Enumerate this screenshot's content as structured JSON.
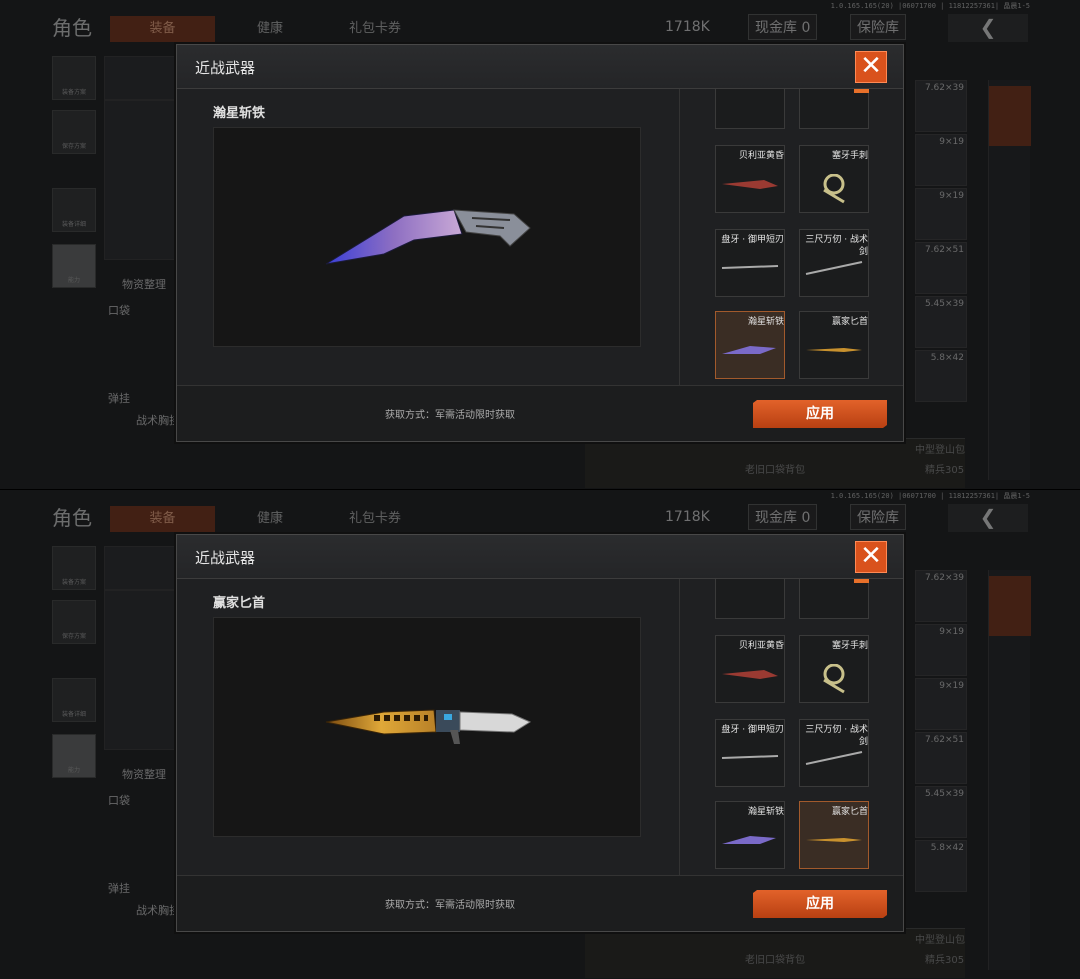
{
  "screens": [
    {
      "build_info": "1.0.165.165(20) |06071700 | 11812257361| 晶晨1-5",
      "page_title": "角色",
      "tabs": [
        "装备",
        "健康",
        "礼包卡券"
      ],
      "currency": {
        "money": "1718K",
        "cash_vault": "现金库 0",
        "safe_box": "保险库"
      },
      "back_icon": "chevron-left-icon",
      "sidebar": [
        "装备方案",
        "保存方案",
        "装备详细",
        "能力"
      ],
      "bg_labels": {
        "supplies": "物资整理",
        "pocket": "口袋",
        "ammo": "弹挂",
        "vest": "战术胸挂",
        "bag_left": "老旧口袋背包",
        "bag_right": "中型登山包",
        "level": "精兵305"
      },
      "ammo_column": [
        "7.62×39",
        "9×19",
        "9×19",
        "7.62×51",
        "5.45×39",
        "5.8×42"
      ],
      "modal": {
        "title": "近战武器",
        "close_icon": "close-icon",
        "selected_name": "瀚星斩铁",
        "obtain_text": "获取方式：军需活动限时获取",
        "apply_label": "应用",
        "items": [
          {
            "name": "",
            "equipped": false,
            "selected": false
          },
          {
            "name": "",
            "equipped": true,
            "selected": false
          },
          {
            "name": "贝利亚黄昏",
            "equipped": false,
            "selected": false
          },
          {
            "name": "塞牙手刺",
            "equipped": false,
            "selected": false
          },
          {
            "name": "盘牙 · 御甲短刃",
            "equipped": false,
            "selected": false
          },
          {
            "name": "三尺万仞 · 战术剑",
            "equipped": false,
            "selected": false
          },
          {
            "name": "瀚星斩铁",
            "equipped": false,
            "selected": true
          },
          {
            "name": "赢家匕首",
            "equipped": false,
            "selected": false
          }
        ]
      }
    },
    {
      "build_info": "1.0.165.165(20) |06071700 | 11812257361| 晶晨1-5",
      "page_title": "角色",
      "tabs": [
        "装备",
        "健康",
        "礼包卡券"
      ],
      "currency": {
        "money": "1718K",
        "cash_vault": "现金库 0",
        "safe_box": "保险库"
      },
      "back_icon": "chevron-left-icon",
      "sidebar": [
        "装备方案",
        "保存方案",
        "装备详细",
        "能力"
      ],
      "bg_labels": {
        "supplies": "物资整理",
        "pocket": "口袋",
        "ammo": "弹挂",
        "vest": "战术胸挂",
        "bag_left": "老旧口袋背包",
        "bag_right": "中型登山包",
        "level": "精兵305"
      },
      "ammo_column": [
        "7.62×39",
        "9×19",
        "9×19",
        "7.62×51",
        "5.45×39",
        "5.8×42"
      ],
      "modal": {
        "title": "近战武器",
        "close_icon": "close-icon",
        "selected_name": "赢家匕首",
        "obtain_text": "获取方式：军需活动限时获取",
        "apply_label": "应用",
        "items": [
          {
            "name": "",
            "equipped": false,
            "selected": false
          },
          {
            "name": "",
            "equipped": true,
            "selected": false
          },
          {
            "name": "贝利亚黄昏",
            "equipped": false,
            "selected": false
          },
          {
            "name": "塞牙手刺",
            "equipped": false,
            "selected": false
          },
          {
            "name": "盘牙 · 御甲短刃",
            "equipped": false,
            "selected": false
          },
          {
            "name": "三尺万仞 · 战术剑",
            "equipped": false,
            "selected": false
          },
          {
            "name": "瀚星斩铁",
            "equipped": false,
            "selected": false
          },
          {
            "name": "赢家匕首",
            "equipped": false,
            "selected": true
          }
        ]
      }
    }
  ],
  "colors": {
    "accent": "#d9521c",
    "blade_purple": "#6a5cc8",
    "blade_gold": "#c8912e"
  }
}
